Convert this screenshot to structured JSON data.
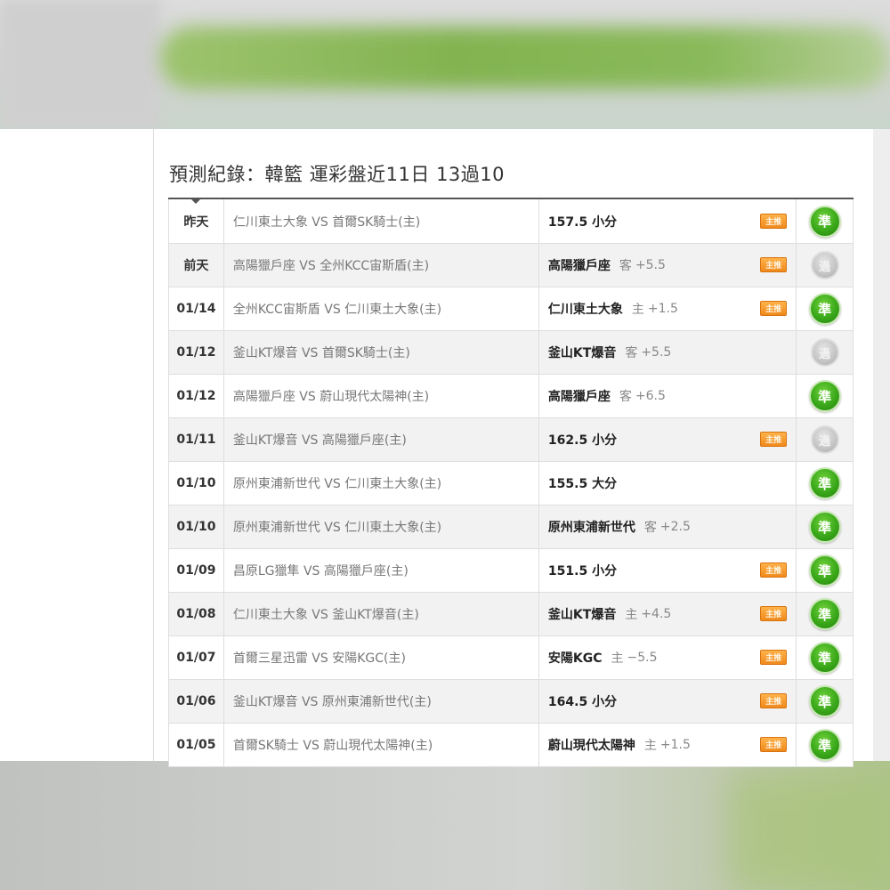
{
  "title": "預測紀錄：韓籃 運彩盤近11日 13過10",
  "hot_label": "主推",
  "rows": [
    {
      "date": "昨天",
      "match": "仁川東土大象 VS 首爾SK騎士(主)",
      "pick": "157.5 小分",
      "side": "",
      "value": "",
      "hot": true,
      "result": "準",
      "result_type": "win"
    },
    {
      "date": "前天",
      "match": "高陽獵戶座 VS 全州KCC宙斯盾(主)",
      "pick": "高陽獵戶座",
      "side": "客",
      "value": "+5.5",
      "hot": true,
      "result": "過",
      "result_type": "push"
    },
    {
      "date": "01/14",
      "match": "全州KCC宙斯盾 VS 仁川東土大象(主)",
      "pick": "仁川東土大象",
      "side": "主",
      "value": "+1.5",
      "hot": true,
      "result": "準",
      "result_type": "win"
    },
    {
      "date": "01/12",
      "match": "釜山KT爆音 VS 首爾SK騎士(主)",
      "pick": "釜山KT爆音",
      "side": "客",
      "value": "+5.5",
      "hot": false,
      "result": "過",
      "result_type": "push"
    },
    {
      "date": "01/12",
      "match": "高陽獵戶座 VS 蔚山現代太陽神(主)",
      "pick": "高陽獵戶座",
      "side": "客",
      "value": "+6.5",
      "hot": false,
      "result": "準",
      "result_type": "win"
    },
    {
      "date": "01/11",
      "match": "釜山KT爆音 VS 高陽獵戶座(主)",
      "pick": "162.5 小分",
      "side": "",
      "value": "",
      "hot": true,
      "result": "過",
      "result_type": "push"
    },
    {
      "date": "01/10",
      "match": "原州東浦新世代 VS 仁川東土大象(主)",
      "pick": "155.5 大分",
      "side": "",
      "value": "",
      "hot": false,
      "result": "準",
      "result_type": "win"
    },
    {
      "date": "01/10",
      "match": "原州東浦新世代 VS 仁川東土大象(主)",
      "pick": "原州東浦新世代",
      "side": "客",
      "value": "+2.5",
      "hot": false,
      "result": "準",
      "result_type": "win"
    },
    {
      "date": "01/09",
      "match": "昌原LG獵隼 VS 高陽獵戶座(主)",
      "pick": "151.5 小分",
      "side": "",
      "value": "",
      "hot": true,
      "result": "準",
      "result_type": "win"
    },
    {
      "date": "01/08",
      "match": "仁川東土大象 VS 釜山KT爆音(主)",
      "pick": "釜山KT爆音",
      "side": "主",
      "value": "+4.5",
      "hot": true,
      "result": "準",
      "result_type": "win"
    },
    {
      "date": "01/07",
      "match": "首爾三星迅雷 VS 安陽KGC(主)",
      "pick": "安陽KGC",
      "side": "主",
      "value": "−5.5",
      "hot": true,
      "result": "準",
      "result_type": "win"
    },
    {
      "date": "01/06",
      "match": "釜山KT爆音 VS 原州東浦新世代(主)",
      "pick": "164.5 小分",
      "side": "",
      "value": "",
      "hot": true,
      "result": "準",
      "result_type": "win"
    },
    {
      "date": "01/05",
      "match": "首爾SK騎士 VS 蔚山現代太陽神(主)",
      "pick": "蔚山現代太陽神",
      "side": "主",
      "value": "+1.5",
      "hot": true,
      "result": "準",
      "result_type": "win"
    }
  ]
}
